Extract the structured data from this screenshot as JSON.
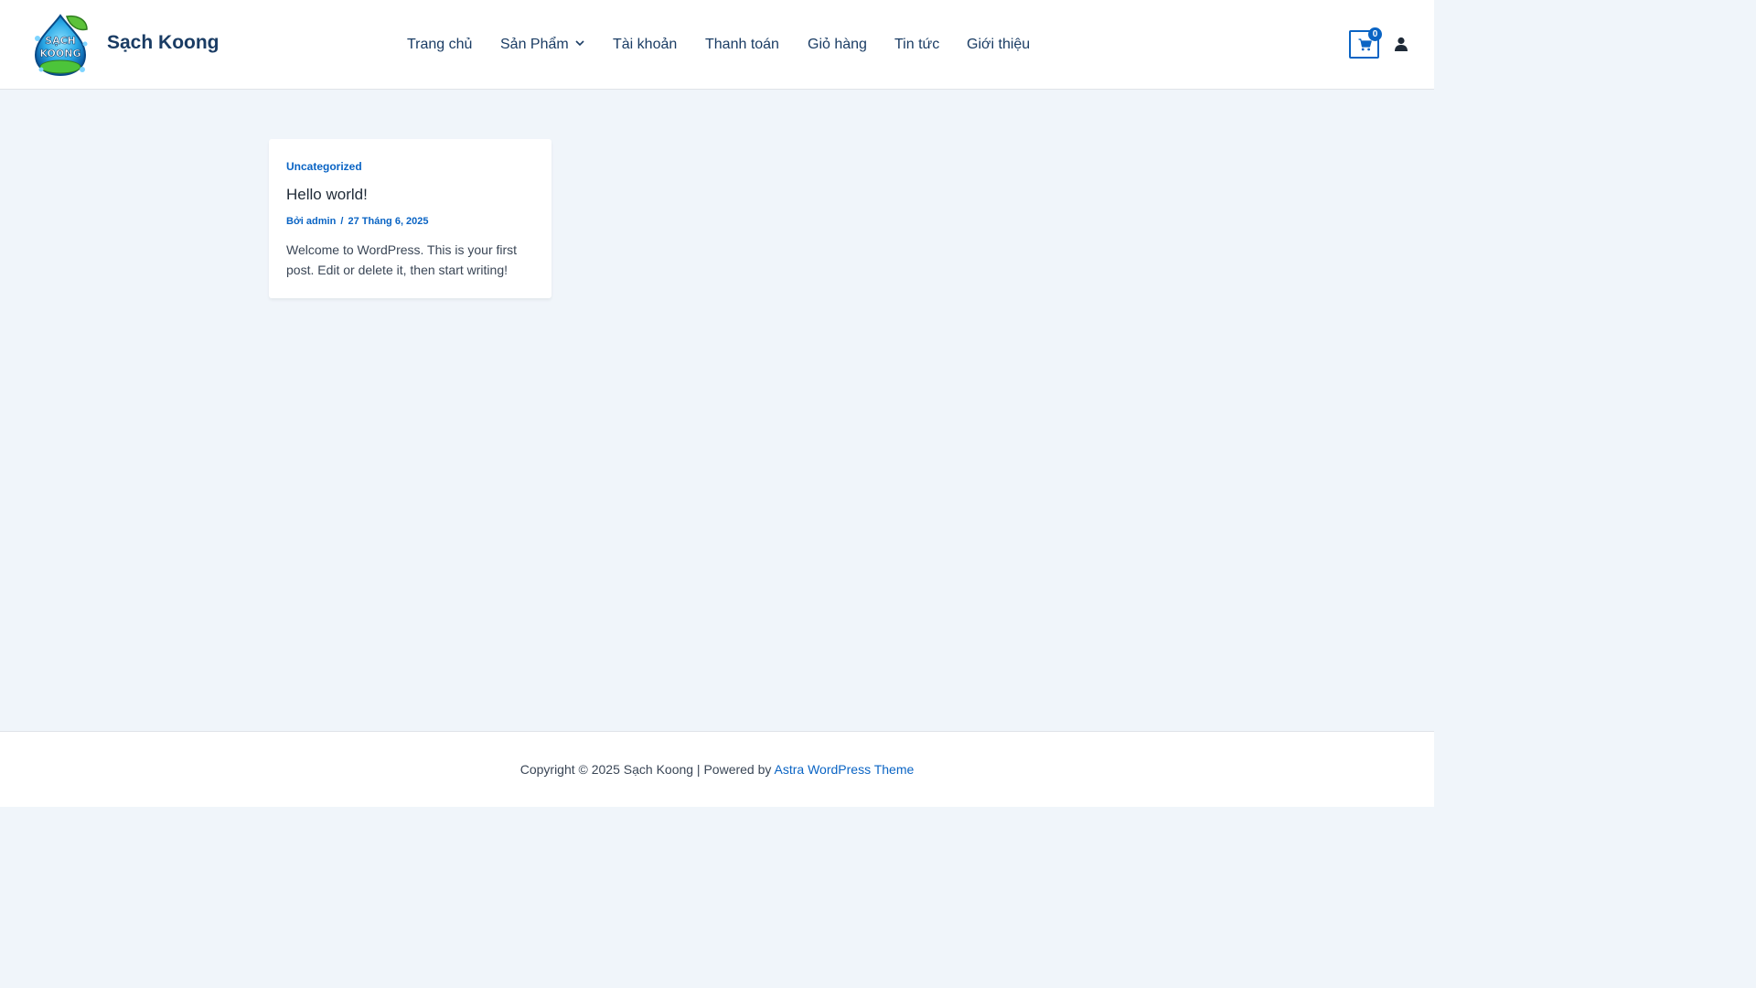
{
  "colors": {
    "brand_dark": "#1a3c64",
    "accent": "#0a64c4",
    "page_bg": "#f0f5fa",
    "surface": "#ffffff"
  },
  "header": {
    "site_title": "Sạch Koong",
    "logo": {
      "icon": "sach-koong-logo",
      "text_top": "SẠCH",
      "text_bottom": "KOONG"
    },
    "nav": [
      {
        "label": "Trang chủ"
      },
      {
        "label": "Sản Phẩm",
        "has_dropdown": true
      },
      {
        "label": "Tài khoản"
      },
      {
        "label": "Thanh toán"
      },
      {
        "label": "Giỏ hàng"
      },
      {
        "label": "Tin tức"
      },
      {
        "label": "Giới thiệu"
      }
    ],
    "cart": {
      "icon": "shopping-cart-icon",
      "count": "0"
    },
    "account": {
      "icon": "user-icon"
    }
  },
  "post": {
    "category": "Uncategorized",
    "title": "Hello world!",
    "author_prefix": "Bởi",
    "author": "admin",
    "separator": "/",
    "date": "27 Tháng 6, 2025",
    "excerpt": "Welcome to WordPress. This is your first post. Edit or delete it, then start writing!"
  },
  "footer": {
    "copyright": "Copyright © 2025 Sạch Koong | Powered by ",
    "theme_link": "Astra WordPress Theme"
  }
}
